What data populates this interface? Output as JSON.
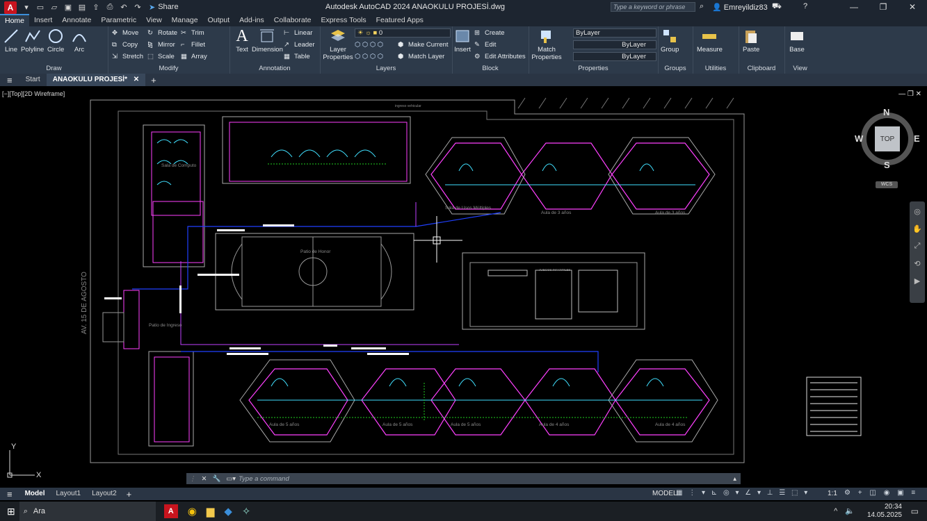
{
  "titlebar": {
    "title": "Autodesk AutoCAD 2024   ANAOKULU PROJESİ.dwg",
    "share_label": "Share",
    "search_placeholder": "Type a keyword or phrase",
    "user": "Emreyildiz83",
    "icons": [
      "new-icon",
      "open-icon",
      "save-icon",
      "saveas-icon",
      "upload-icon",
      "print-icon",
      "undo-icon",
      "redo-icon"
    ]
  },
  "ribbon_tabs": [
    "Home",
    "Insert",
    "Annotate",
    "Parametric",
    "View",
    "Manage",
    "Output",
    "Add-ins",
    "Collaborate",
    "Express Tools",
    "Featured Apps"
  ],
  "ribbon": {
    "draw": {
      "title": "Draw",
      "buttons": [
        "Line",
        "Polyline",
        "Circle",
        "Arc"
      ]
    },
    "modify": {
      "title": "Modify",
      "col1": [
        "Move",
        "Copy",
        "Stretch"
      ],
      "col2": [
        "Rotate",
        "Mirror",
        "Scale"
      ],
      "col3": [
        "Trim",
        "Fillet",
        "Array"
      ]
    },
    "annotation": {
      "title": "Annotation",
      "text": "Text",
      "dimension": "Dimension",
      "small": [
        "Linear",
        "Leader",
        "Table"
      ]
    },
    "layers": {
      "title": "Layers",
      "properties": "Layer Properties",
      "current_layer": "0",
      "small": [
        "Make Current",
        "Match Layer"
      ]
    },
    "block": {
      "title": "Block",
      "insert": "Insert",
      "small": [
        "Create",
        "Edit",
        "Edit Attributes"
      ]
    },
    "properties": {
      "title": "Properties",
      "match": "Match Properties",
      "values": [
        "ByLayer",
        "ByLayer",
        "ByLayer"
      ]
    },
    "groups": {
      "title": "Groups",
      "group": "Group"
    },
    "utilities": {
      "title": "Utilities",
      "measure": "Measure"
    },
    "clipboard": {
      "title": "Clipboard",
      "paste": "Paste"
    },
    "view": {
      "title": "View",
      "base": "Base"
    }
  },
  "file_tabs": [
    "Start",
    "ANAOKULU PROJESİ*"
  ],
  "viewport": {
    "label": "[−][Top][2D Wireframe]",
    "viewcube": {
      "top": "TOP",
      "n": "N",
      "s": "S",
      "e": "E",
      "w": "W",
      "wcs": "WCS"
    },
    "street_label": "AV. 15 DE AGOSTO",
    "rooms": {
      "sala_computo": "Sala de Computo",
      "sala_usos": "Sala de Usos Múltiples",
      "aula3a": "Aula de 3 años",
      "aula3b": "Aula de 3 años",
      "patio_honor": "Patio de Honor",
      "patio_ingreso": "Patio de Ingreso",
      "aula5a": "Aula de 5 años",
      "aula5b": "Aula de 5 años",
      "aula5c": "Aula de 5 años",
      "aula4a": "Aula de 4 años",
      "aula4b": "Aula de 4 años",
      "juegos": "JUEGOS INFANTILES",
      "ingreso_vehic": "ingreso vehicular"
    },
    "axis": {
      "x": "X",
      "y": "Y"
    }
  },
  "command_line": {
    "placeholder": "Type  a  command"
  },
  "layout_tabs": [
    "Model",
    "Layout1",
    "Layout2"
  ],
  "status": {
    "model": "MODEL",
    "scale": "1:1"
  },
  "taskbar": {
    "search": "Ara",
    "time": "20:34",
    "date": "14.05.2025"
  }
}
